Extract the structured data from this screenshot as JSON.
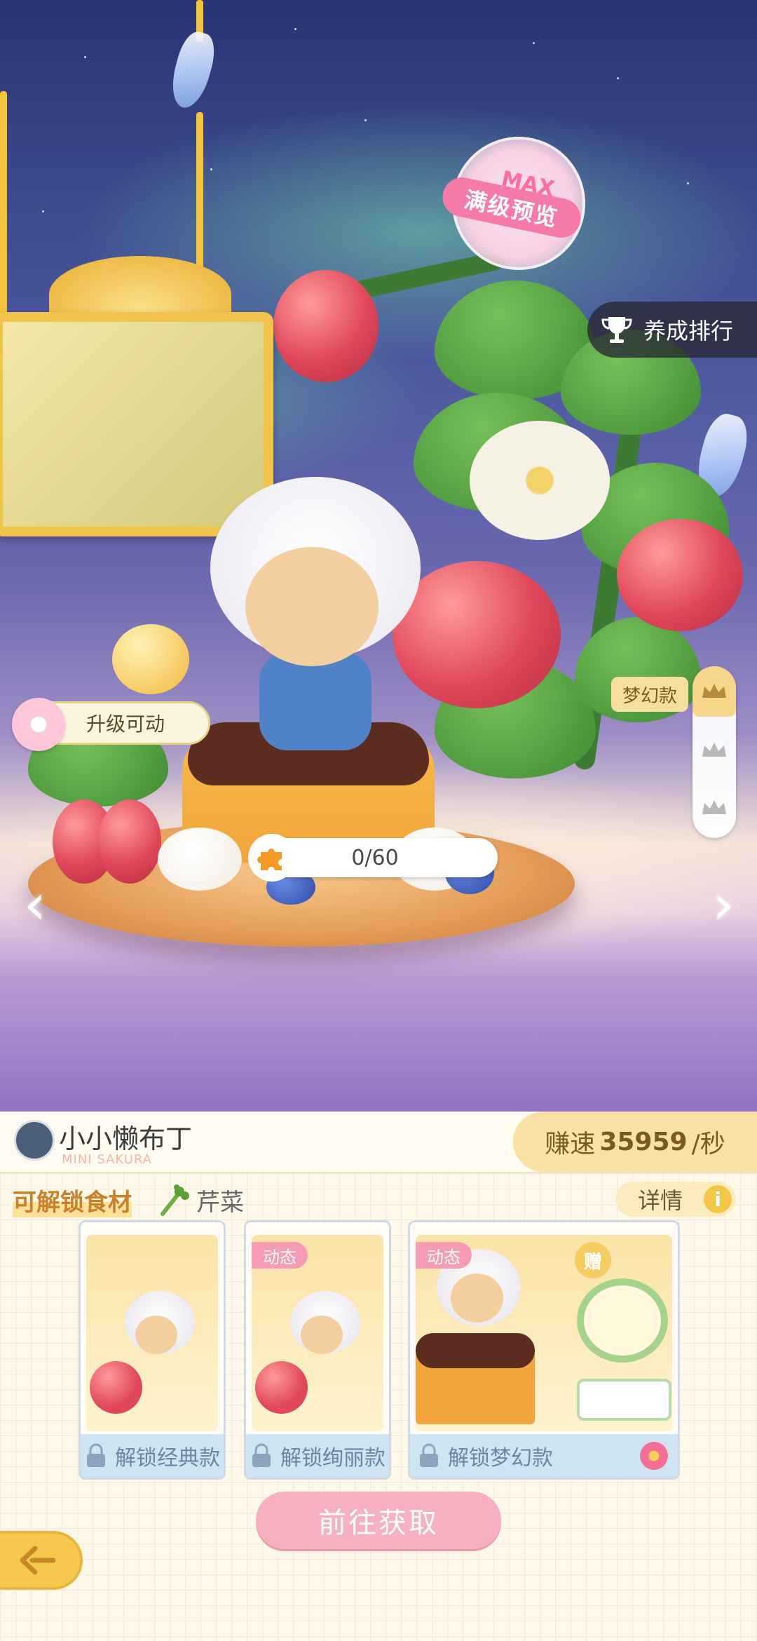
{
  "scene": {
    "max_label": "MAX",
    "preview_label": "满级预览",
    "ranking_label": "养成排行",
    "upgrade_label": "升级可动",
    "progress_text": "0/60",
    "tier_tag": "梦幻款",
    "tiers": [
      "crown-top",
      "crown-mid",
      "crown-low"
    ]
  },
  "panel": {
    "char_name": "小小懒布丁",
    "char_sub": "MINI SAKURA",
    "speed_prefix": "赚速",
    "speed_value": "35959",
    "speed_unit": "/秒",
    "unlock_label": "可解锁食材",
    "ingredient_name": "芹菜",
    "details_label": "详情",
    "cards": [
      {
        "badge": "",
        "label": "解锁经典款"
      },
      {
        "badge": "动态",
        "label": "解锁绚丽款"
      },
      {
        "badge": "动态",
        "label": "解锁梦幻款",
        "gift": "赠"
      }
    ],
    "go_button": "前往获取"
  },
  "colors": {
    "accent_pink": "#f6b0bf",
    "gold": "#f6c94e",
    "speed_bg": "#fbe0a6"
  }
}
